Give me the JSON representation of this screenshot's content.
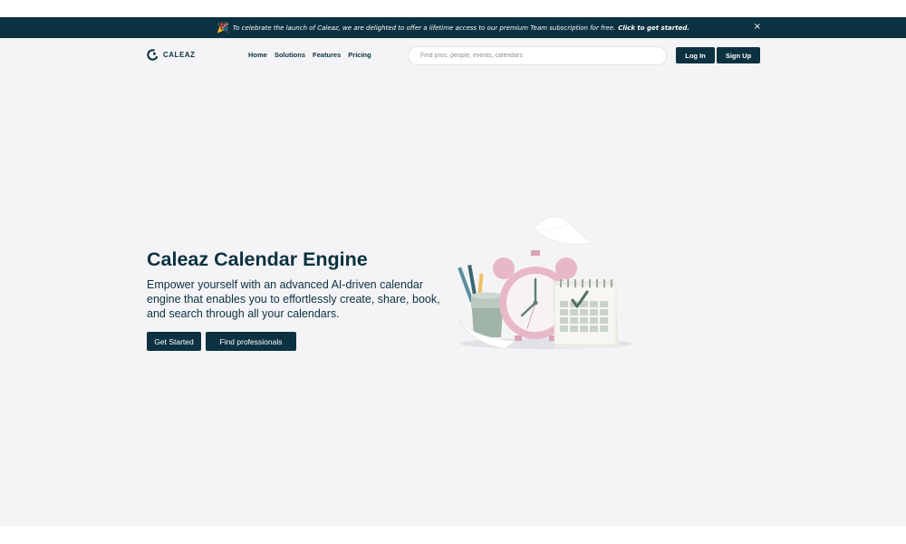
{
  "announcement": {
    "party_emoji": "🎉",
    "text": "To celebrate the launch of Caleaz, we are delighted to offer a lifetime access to our premium Team subscription for free.",
    "link_text": "Click to get started.",
    "close_glyph": "×"
  },
  "nav": {
    "logo_text": "CALEAZ",
    "menu": [
      "Home",
      "Solutions",
      "Features",
      "Pricing"
    ],
    "search_placeholder": "Find pros, people, events, calendars",
    "login_label": "Log In",
    "signup_label": "Sign Up"
  },
  "hero": {
    "title": "Caleaz Calendar Engine",
    "description": "Empower yourself with an advanced AI-driven calendar engine that enables you to effortlessly create, share, book, and search through all your calendars.",
    "cta_primary": "Get Started",
    "cta_secondary": "Find professionals",
    "illustration": "alarm-clock-calendar-pencil-cup-illustration"
  },
  "colors": {
    "primary": "#0c3140",
    "background": "#f4f4f6",
    "clock_pink": "#e8b8c8",
    "cup_green": "#9fb3a6"
  }
}
